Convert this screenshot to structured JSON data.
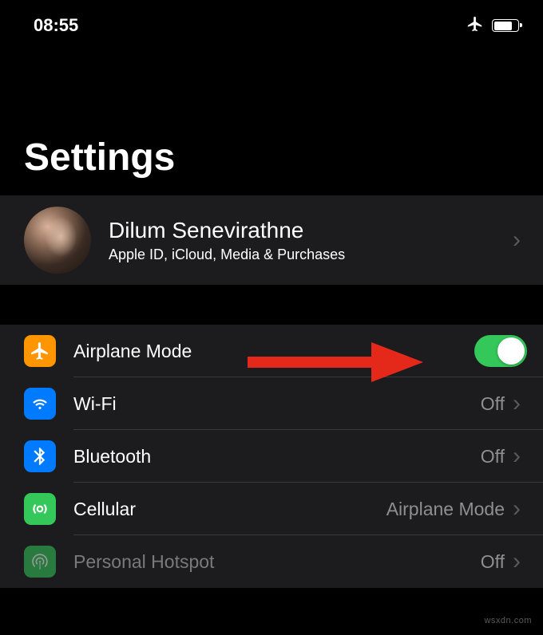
{
  "status": {
    "time": "08:55"
  },
  "page": {
    "title": "Settings"
  },
  "account": {
    "name": "Dilum Senevirathne",
    "subtitle": "Apple ID, iCloud, Media & Purchases"
  },
  "settings": {
    "airplane": {
      "label": "Airplane Mode",
      "on": true
    },
    "wifi": {
      "label": "Wi-Fi",
      "value": "Off"
    },
    "bluetooth": {
      "label": "Bluetooth",
      "value": "Off"
    },
    "cellular": {
      "label": "Cellular",
      "value": "Airplane Mode"
    },
    "hotspot": {
      "label": "Personal Hotspot",
      "value": "Off"
    }
  },
  "watermark": "wsxdn.com"
}
